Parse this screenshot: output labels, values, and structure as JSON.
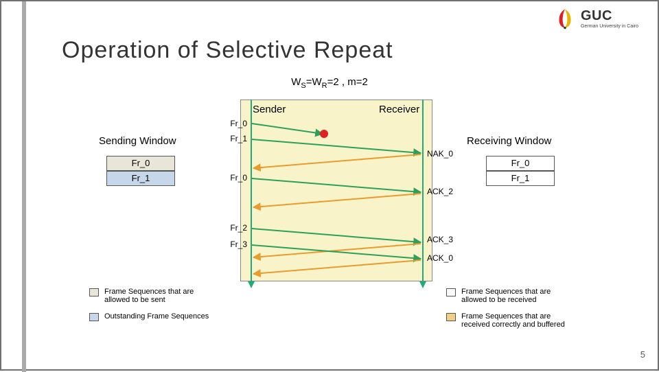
{
  "title": "Operation of Selective Repeat",
  "params": "W",
  "params_full": {
    "pre": "W",
    "s": "S",
    "mid": "=W",
    "r": "R",
    "post": "=2 , m=2"
  },
  "roles": {
    "sender": "Sender",
    "receiver": "Receiver"
  },
  "left": {
    "title": "Sending Window",
    "rows": [
      "Fr_0",
      "Fr_1"
    ]
  },
  "right": {
    "title": "Receiving Window",
    "rows": [
      "Fr_0",
      "Fr_1"
    ]
  },
  "frames": [
    "Fr_0",
    "Fr_1",
    "Fr_0",
    "Fr_2",
    "Fr_3"
  ],
  "acks": [
    "NAK_0",
    "ACK_2",
    "ACK_3",
    "ACK_0"
  ],
  "legend": {
    "l1": "Frame Sequences that are allowed to be sent",
    "l2": "Outstanding Frame Sequences",
    "r1": "Frame Sequences that are allowed to be received",
    "r2": "Frame Sequences that are received correctly and buffered"
  },
  "logo": {
    "text": "GUC",
    "sub": "German University in Cairo"
  },
  "page": "5",
  "colors": {
    "green": "#2ca05a",
    "red": "#d22",
    "orange": "#e89c2e",
    "swatch_sent": "#e8e6d8",
    "swatch_out": "#c5d7e8",
    "swatch_recv": "#ffffff",
    "swatch_buf": "#f3cf86"
  }
}
